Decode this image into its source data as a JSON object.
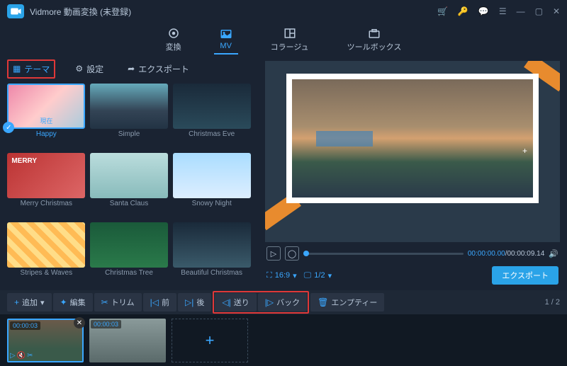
{
  "app": {
    "title": "Vidmore 動画変換 (未登録)"
  },
  "topnav": {
    "items": [
      {
        "label": "変換"
      },
      {
        "label": "MV"
      },
      {
        "label": "コラージュ"
      },
      {
        "label": "ツールボックス"
      }
    ]
  },
  "subtabs": {
    "theme": "テーマ",
    "settings": "設定",
    "export": "エクスポート"
  },
  "themes": [
    {
      "label": "Happy",
      "now": "現在"
    },
    {
      "label": "Simple"
    },
    {
      "label": "Christmas Eve"
    },
    {
      "label": "Merry Christmas",
      "deco": "MERRY"
    },
    {
      "label": "Santa Claus"
    },
    {
      "label": "Snowy Night"
    },
    {
      "label": "Stripes & Waves"
    },
    {
      "label": "Christmas Tree"
    },
    {
      "label": "Beautiful Christmas"
    }
  ],
  "preview": {
    "current_time": "00:00:00.00",
    "total_time": "00:00:09.14",
    "aspect": "16:9",
    "page": "1/2",
    "export": "エクスポート"
  },
  "toolbar": {
    "add": "追加",
    "edit": "編集",
    "trim": "トリム",
    "front": "前",
    "back": "後",
    "send": "送り",
    "back2": "バック",
    "empty": "エンプティー",
    "page_indicator": "1 / 2"
  },
  "timeline": {
    "clips": [
      {
        "duration": "00:00:03"
      },
      {
        "duration": "00:00:03"
      }
    ]
  }
}
